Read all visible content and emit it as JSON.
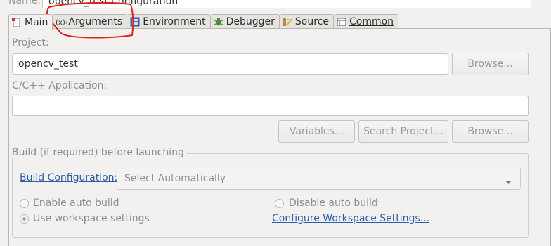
{
  "name": {
    "label": "Name:",
    "value": "opencv_test Configuration"
  },
  "tabs": [
    {
      "label": "Main",
      "icon": "main-tab-icon"
    },
    {
      "label": "Arguments",
      "icon": "arguments-icon"
    },
    {
      "label": "Environment",
      "icon": "environment-icon"
    },
    {
      "label": "Debugger",
      "icon": "debugger-icon"
    },
    {
      "label": "Source",
      "icon": "source-icon"
    },
    {
      "label": "Common",
      "icon": "common-icon"
    }
  ],
  "project": {
    "label": "Project:",
    "value": "opencv_test",
    "browse": "Browse..."
  },
  "application": {
    "label": "C/C++ Application:",
    "value": "",
    "variables": "Variables...",
    "search": "Search Project...",
    "browse": "Browse..."
  },
  "build": {
    "group_title": "Build (if required) before launching",
    "config_link": "Build Configuration:",
    "config_value": "Select Automatically",
    "enable": "Enable auto build",
    "disable": "Disable auto build",
    "workspace": "Use workspace settings",
    "configure_link": "Configure Workspace Settings..."
  },
  "colors": {
    "annotation": "#e0201b",
    "link": "#2a5ea8"
  }
}
